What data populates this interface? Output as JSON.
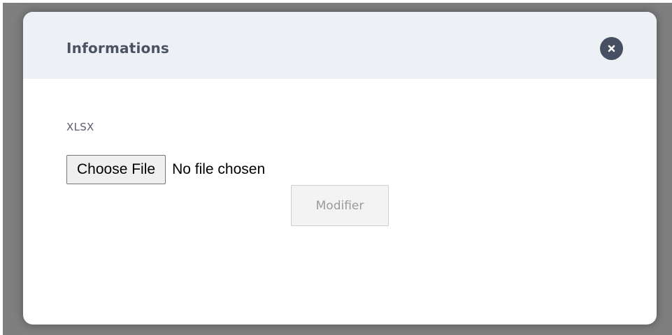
{
  "modal": {
    "title": "Informations",
    "close_icon": "close-icon"
  },
  "form": {
    "field_label": "XLSX",
    "file_input": {
      "button_label": "Choose File",
      "status_text": "No file chosen"
    },
    "submit_label": "Modifier"
  },
  "colors": {
    "backdrop": "#7f7f7f",
    "header_bg": "#edf0f5",
    "title_text": "#4a5266",
    "close_button_bg": "#474f63"
  }
}
